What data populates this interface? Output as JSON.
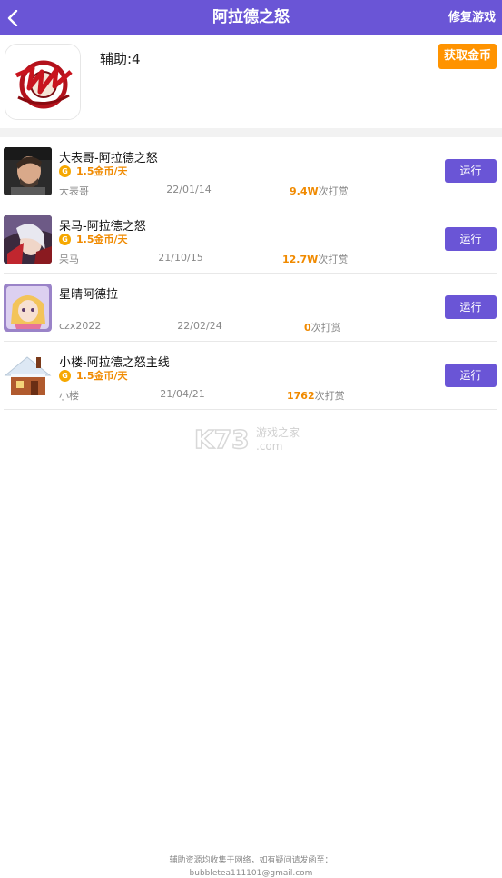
{
  "header": {
    "title": "阿拉德之怒",
    "repair_label": "修复游戏"
  },
  "game": {
    "helper_count": "辅助:4",
    "get_coins_label": "获取金币"
  },
  "coin_symbol": "G",
  "tips_suffix": "次打赏",
  "run_label": "运行",
  "scripts": [
    {
      "name": "大表哥-阿拉德之怒",
      "price": "1.5金币/天",
      "author": "大表哥",
      "date": "22/01/14",
      "tips": "9.4W"
    },
    {
      "name": "呆马-阿拉德之怒",
      "price": "1.5金币/天",
      "author": "呆马",
      "date": "21/10/15",
      "tips": "12.7W"
    },
    {
      "name": "星晴阿德拉",
      "price": "",
      "author": "czx2022",
      "date": "22/02/24",
      "tips": "0"
    },
    {
      "name": "小楼-阿拉德之怒主线",
      "price": "1.5金币/天",
      "author": "小楼",
      "date": "21/04/21",
      "tips": "1762"
    }
  ],
  "watermark": {
    "logo": "K73",
    "text": "游戏之家",
    "domain": ".com"
  },
  "footer": {
    "line1": "辅助资源均收集于网络，如有疑问请发函至：",
    "line2": "bubbletea111101@gmail.com"
  },
  "colors": {
    "header": "#6a55d6",
    "accent_orange": "#ff9300",
    "button": "#6a55d6",
    "price": "#f08a00"
  }
}
